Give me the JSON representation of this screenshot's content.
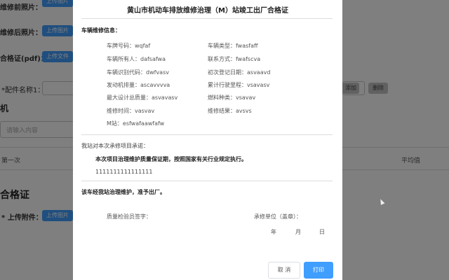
{
  "background": {
    "row1_label": "维修前照片：",
    "row2_label": "维修后照片：",
    "row2_button": "上传图片",
    "row3_label": "合格证(pdf)：",
    "row3_button": "上传文件",
    "row4_label": "*配件名称1：",
    "add_button": "添加",
    "delete_button": "删除",
    "left_fragment": "机",
    "input_placeholder": "请输入内容",
    "col_left": "第一次",
    "col_right": "平均值",
    "section_title": "合格证",
    "upload_label": "* 上传附件：",
    "upload_button": "上传图片"
  },
  "dialog": {
    "title": "黄山市机动车排放维修治理（M）站竣工出厂合格证",
    "vehicle_info_title": "车辆维修信息：",
    "fields_left": [
      "车牌号码：wqfaf",
      "车辆所有人：dafsafwa",
      "车辆识别代码：dwfvasv",
      "发动机排量：ascavvvva",
      "最大设计总质量：asvavasv",
      "维修时间：vasvav",
      "M站：esfwafaawfafw"
    ],
    "fields_right": [
      "车辆类型：fwasfaff",
      "联系方式：fwafscva",
      "初次登记日期：asvaavd",
      "累计行驶里程：vsavasv",
      "燃料种类：vsavav",
      "维修结果：avsvs"
    ],
    "promise_title": "我站对本次承修项目承诺：",
    "promise_text": "本次项目治理维护质量保证期，按照国家有关行业规定执行。",
    "promise_value": "1111111111111111",
    "release_text": "该车经我站治理维护，准予出厂。",
    "inspector_label": "质量检验员签字：",
    "repair_unit_label": "承修单位（盖章）：",
    "date_year": "年",
    "date_month": "月",
    "date_day": "日",
    "cancel_label": "取 消",
    "print_label": "打印"
  }
}
